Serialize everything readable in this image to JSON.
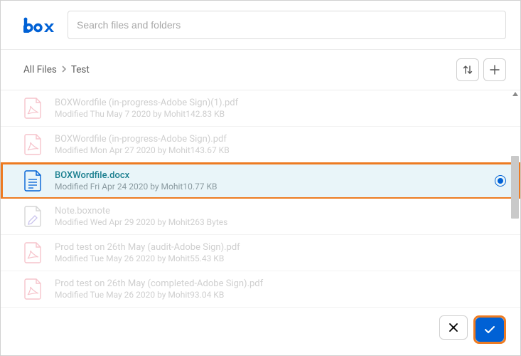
{
  "brand": "box",
  "search": {
    "placeholder": "Search files and folders"
  },
  "breadcrumb": {
    "root": "All Files",
    "current": "Test"
  },
  "files": [
    {
      "name": "BOXWordfile (in-progress-Adobe Sign)(1).pdf",
      "meta": "Modified Thu May 7 2020 by Mohit142.83 KB",
      "icon": "pdf",
      "selected": false,
      "faded": true
    },
    {
      "name": "BOXWordfile (in-progress-Adobe Sign).pdf",
      "meta": "Modified Mon Apr 27 2020 by Mohit143.67 KB",
      "icon": "pdf",
      "selected": false,
      "faded": true
    },
    {
      "name": "BOXWordfile.docx",
      "meta": "Modified Fri Apr 24 2020 by Mohit10.77 KB",
      "icon": "docx",
      "selected": true,
      "faded": false
    },
    {
      "name": "Note.boxnote",
      "meta": "Modified Wed Apr 29 2020 by Mohit263 Bytes",
      "icon": "boxnote",
      "selected": false,
      "faded": true
    },
    {
      "name": "Prod test on 26th May (audit-Adobe Sign).pdf",
      "meta": "Modified Tue May 26 2020 by Mohit55.43 KB",
      "icon": "pdf",
      "selected": false,
      "faded": true
    },
    {
      "name": "Prod test on 26th May (completed-Adobe Sign).pdf",
      "meta": "Modified Tue May 26 2020 by Mohit93.04 KB",
      "icon": "pdf",
      "selected": false,
      "faded": true
    }
  ]
}
